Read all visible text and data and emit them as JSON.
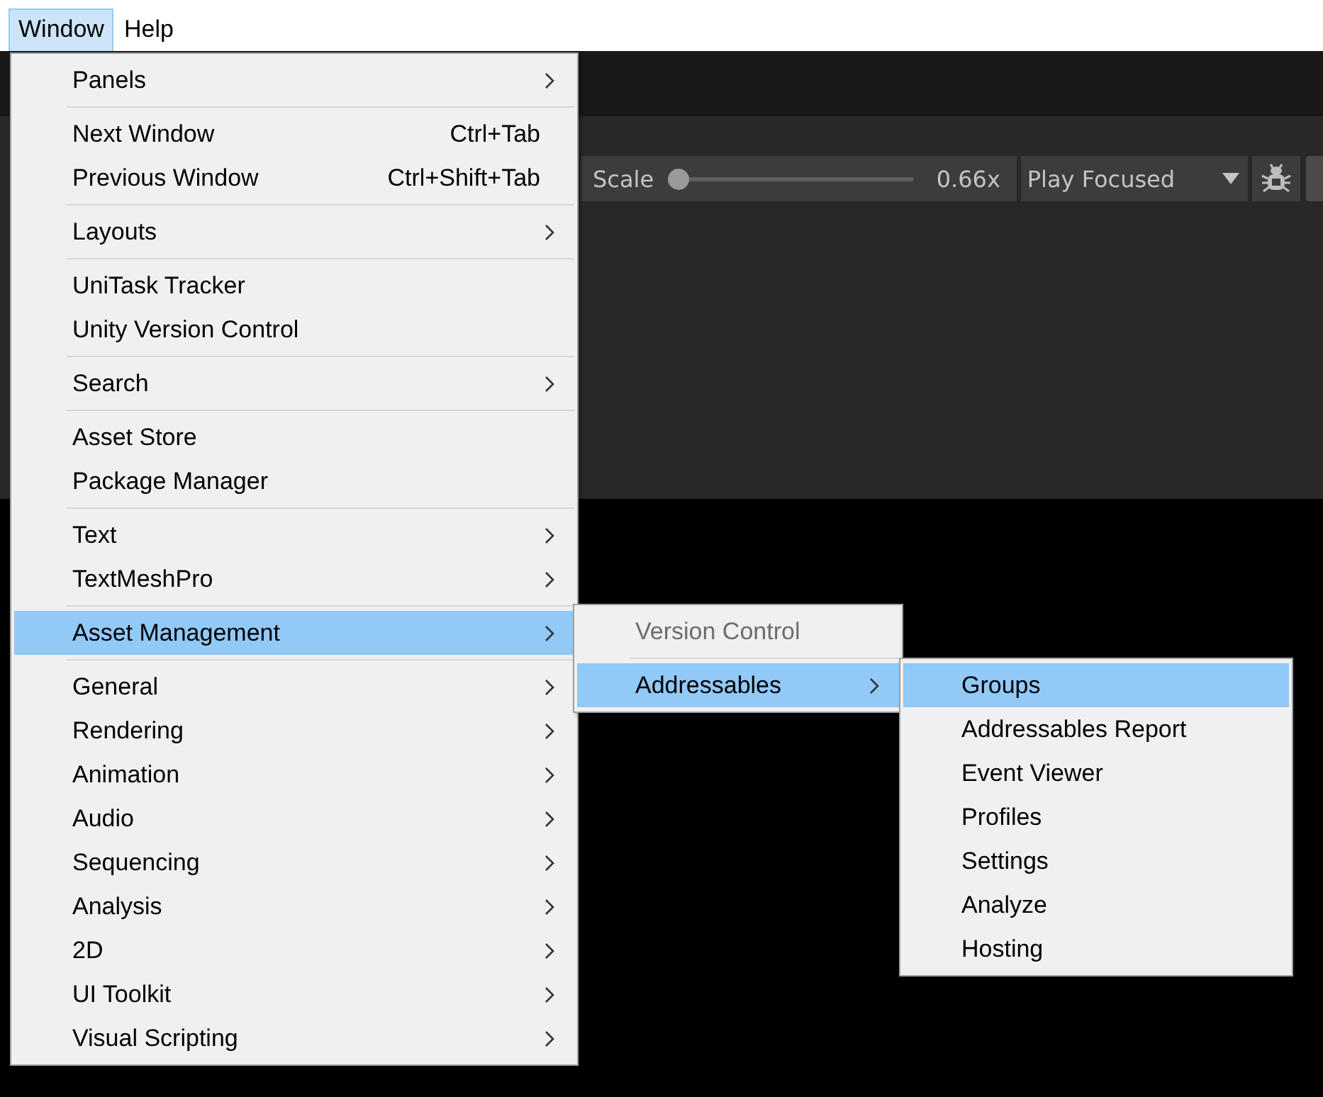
{
  "menubar": [
    {
      "label": "Window",
      "selected": true
    },
    {
      "label": "Help",
      "selected": false
    }
  ],
  "toolbar": {
    "scale": {
      "label": "Scale",
      "level": 0,
      "reading": "0.66x"
    },
    "play_mode": {
      "value": "Play Focused"
    }
  },
  "menu": {
    "groups": [
      [
        {
          "label": "Panels",
          "has_submenu": true,
          "selected": false,
          "disabled": false
        }
      ],
      [
        {
          "label": "Next Window",
          "shortcut": "Ctrl+Tab",
          "has_submenu": false,
          "selected": false,
          "disabled": false
        },
        {
          "label": "Previous Window",
          "shortcut": "Ctrl+Shift+Tab",
          "has_submenu": false,
          "selected": false,
          "disabled": false
        }
      ],
      [
        {
          "label": "Layouts",
          "has_submenu": true,
          "selected": false,
          "disabled": false
        }
      ],
      [
        {
          "label": "UniTask Tracker",
          "has_submenu": false,
          "selected": false,
          "disabled": false
        },
        {
          "label": "Unity Version Control",
          "has_submenu": false,
          "selected": false,
          "disabled": false
        }
      ],
      [
        {
          "label": "Search",
          "has_submenu": true,
          "selected": false,
          "disabled": false
        }
      ],
      [
        {
          "label": "Asset Store",
          "has_submenu": false,
          "selected": false,
          "disabled": false
        },
        {
          "label": "Package Manager",
          "has_submenu": false,
          "selected": false,
          "disabled": false
        }
      ],
      [
        {
          "label": "Text",
          "has_submenu": true,
          "selected": false,
          "disabled": false
        },
        {
          "label": "TextMeshPro",
          "has_submenu": true,
          "selected": false,
          "disabled": false
        }
      ],
      [
        {
          "label": "Asset Management",
          "has_submenu": true,
          "selected": true,
          "disabled": false,
          "submenu": {
            "groups": [
              [
                {
                  "label": "Version Control",
                  "has_submenu": false,
                  "selected": false,
                  "disabled": true
                }
              ],
              [
                {
                  "label": "Addressables",
                  "has_submenu": true,
                  "selected": true,
                  "disabled": false,
                  "submenu": {
                    "groups": [
                      [
                        {
                          "label": "Groups",
                          "has_submenu": false,
                          "selected": true,
                          "disabled": false
                        },
                        {
                          "label": "Addressables Report",
                          "has_submenu": false,
                          "selected": false,
                          "disabled": false
                        },
                        {
                          "label": "Event Viewer",
                          "has_submenu": false,
                          "selected": false,
                          "disabled": false
                        },
                        {
                          "label": "Profiles",
                          "has_submenu": false,
                          "selected": false,
                          "disabled": false
                        },
                        {
                          "label": "Settings",
                          "has_submenu": false,
                          "selected": false,
                          "disabled": false
                        },
                        {
                          "label": "Analyze",
                          "has_submenu": false,
                          "selected": false,
                          "disabled": false
                        },
                        {
                          "label": "Hosting",
                          "has_submenu": false,
                          "selected": false,
                          "disabled": false
                        }
                      ]
                    ]
                  }
                }
              ]
            ]
          }
        }
      ],
      [
        {
          "label": "General",
          "has_submenu": true,
          "selected": false,
          "disabled": false
        },
        {
          "label": "Rendering",
          "has_submenu": true,
          "selected": false,
          "disabled": false
        },
        {
          "label": "Animation",
          "has_submenu": true,
          "selected": false,
          "disabled": false
        },
        {
          "label": "Audio",
          "has_submenu": true,
          "selected": false,
          "disabled": false
        },
        {
          "label": "Sequencing",
          "has_submenu": true,
          "selected": false,
          "disabled": false
        },
        {
          "label": "Analysis",
          "has_submenu": true,
          "selected": false,
          "disabled": false
        },
        {
          "label": "2D",
          "has_submenu": true,
          "selected": false,
          "disabled": false
        },
        {
          "label": "UI Toolkit",
          "has_submenu": true,
          "selected": false,
          "disabled": false
        },
        {
          "label": "Visual Scripting",
          "has_submenu": true,
          "selected": false,
          "disabled": false
        }
      ]
    ]
  }
}
